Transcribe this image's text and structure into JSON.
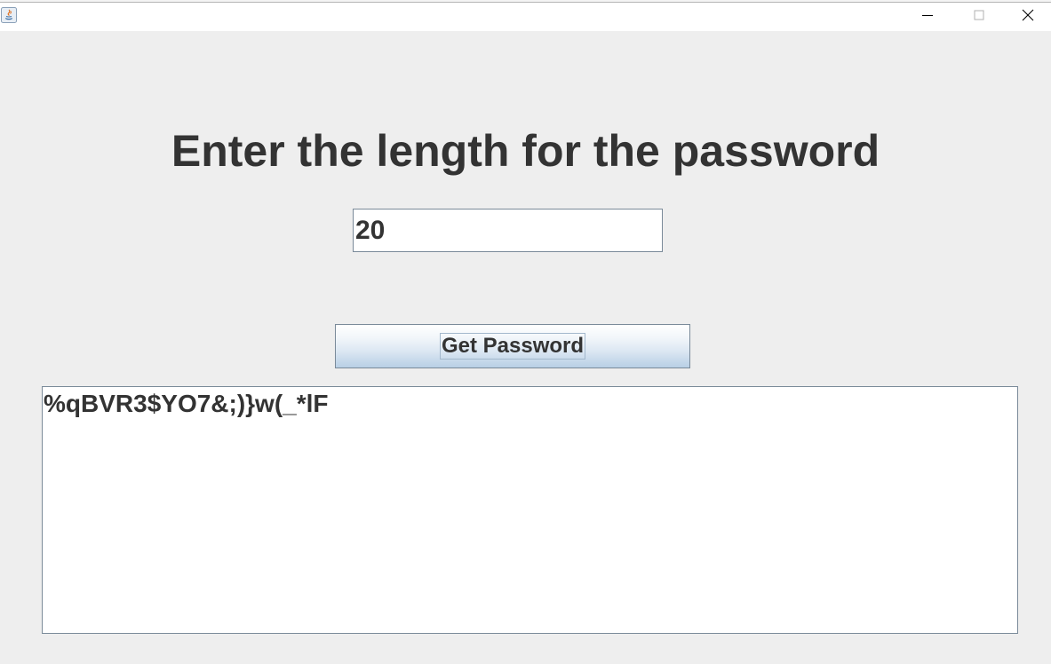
{
  "window": {
    "title": "",
    "controls": {
      "minimize_icon": "minimize-icon",
      "maximize_icon": "maximize-icon",
      "close_icon": "close-icon"
    }
  },
  "main": {
    "heading": "Enter the length for the password",
    "length_input": {
      "value": "20"
    },
    "get_password_button": {
      "label": "Get Password"
    },
    "output": {
      "text": "%qBVR3$YO7&;)}w(_*lF"
    }
  },
  "colors": {
    "background": "#eeeeee",
    "text": "#333333",
    "border": "#7a8a99",
    "button_gradient_bottom": "#b8cfe5"
  }
}
